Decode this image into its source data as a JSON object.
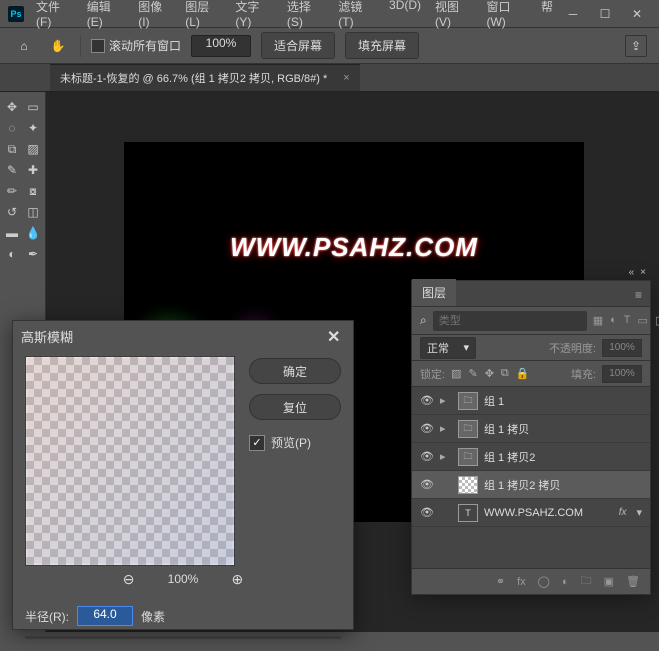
{
  "menu": {
    "items": [
      "文件(F)",
      "编辑(E)",
      "图像(I)",
      "图层(L)",
      "文字(Y)",
      "选择(S)",
      "滤镜(T)",
      "3D(D)",
      "视图(V)",
      "窗口(W)",
      "帮"
    ]
  },
  "options": {
    "scroll_all": "滚动所有窗口",
    "zoom": "100%",
    "fit_screen": "适合屏幕",
    "fill_screen": "填充屏幕"
  },
  "doc": {
    "tab_title": "未标题-1-恢复的 @ 66.7% (组 1 拷贝2 拷贝, RGB/8#) *"
  },
  "canvas": {
    "watermark": "WWW.PSAHZ.COM"
  },
  "dialog": {
    "title": "高斯模糊",
    "ok": "确定",
    "reset": "复位",
    "preview": "预览(P)",
    "zoom_pct": "100%",
    "radius_label": "半径(R):",
    "radius_value": "64.0",
    "radius_unit": "像素"
  },
  "layers": {
    "tab": "图层",
    "filter_placeholder": "类型",
    "filter_prefix": "⌕",
    "blend_mode": "正常",
    "opacity_label": "不透明度:",
    "opacity_value": "100%",
    "lock_label": "锁定:",
    "fill_label": "填充:",
    "fill_value": "100%",
    "items": [
      {
        "name": "组 1",
        "type": "folder"
      },
      {
        "name": "组 1 拷贝",
        "type": "folder"
      },
      {
        "name": "组 1 拷贝2",
        "type": "folder"
      },
      {
        "name": "组 1 拷贝2 拷贝",
        "type": "layer",
        "selected": true
      },
      {
        "name": "WWW.PSAHZ.COM",
        "type": "text",
        "fx": "fx"
      }
    ]
  }
}
